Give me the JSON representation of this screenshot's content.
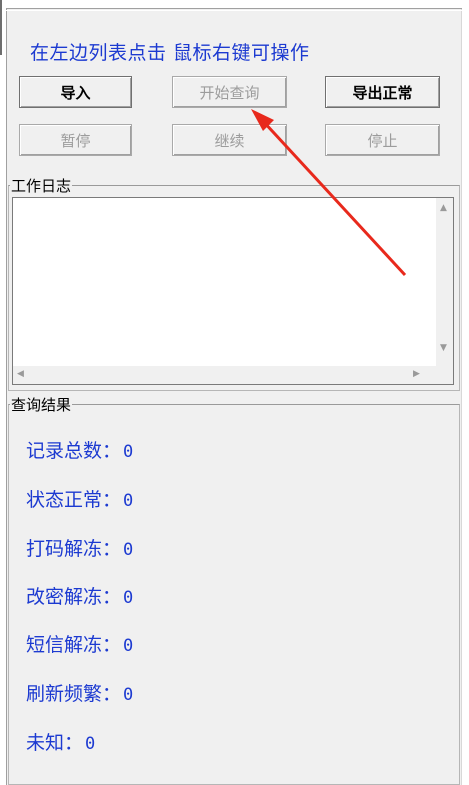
{
  "hint_text": "在左边列表点击 鼠标右键可操作",
  "buttons": {
    "import": "导入",
    "start_query": "开始查询",
    "export_normal": "导出正常",
    "pause": "暂停",
    "resume": "继续",
    "stop": "停止"
  },
  "log_group": {
    "label": "工作日志"
  },
  "result_group": {
    "label": "查询结果"
  },
  "stats": [
    {
      "label": "记录总数：",
      "value": "0"
    },
    {
      "label": "状态正常：",
      "value": "0"
    },
    {
      "label": "打码解冻：",
      "value": "0"
    },
    {
      "label": "改密解冻：",
      "value": "0"
    },
    {
      "label": "短信解冻：",
      "value": "0"
    },
    {
      "label": "刷新频繁：",
      "value": "0"
    },
    {
      "label": "未知：",
      "value": "0"
    }
  ],
  "colors": {
    "accent_text": "#1c3ad1",
    "annotation_arrow": "#e8291c",
    "panel_bg": "#f0f0f0"
  }
}
